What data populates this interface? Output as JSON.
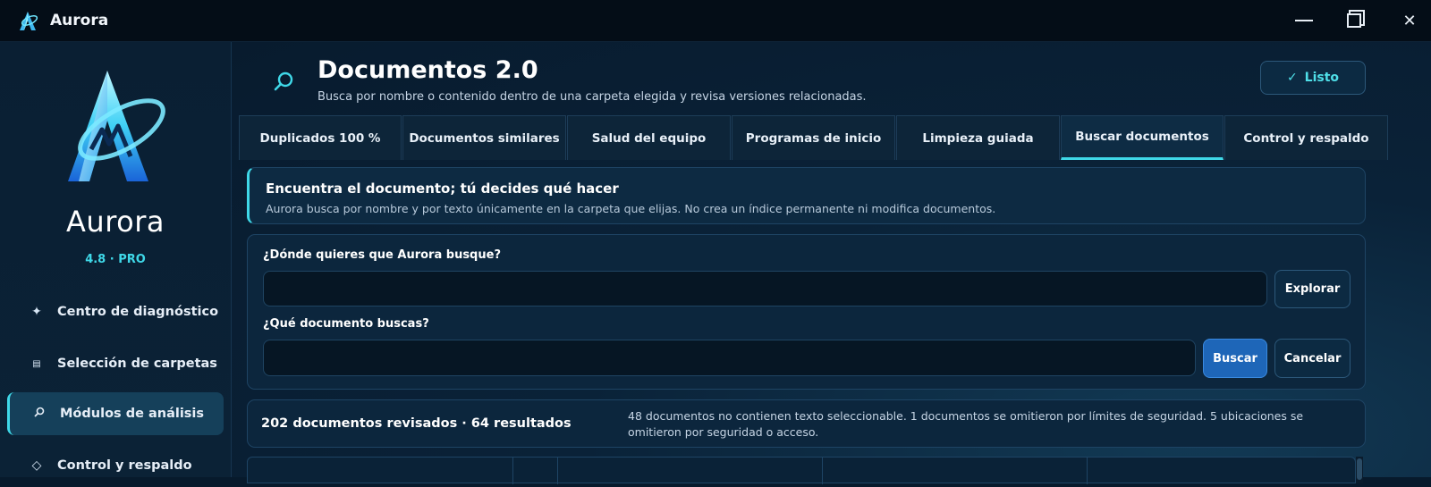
{
  "window": {
    "title": "Aurora",
    "controls": {
      "minimize": "minimize-icon",
      "maximize": "maximize-icon",
      "close": "close-icon"
    }
  },
  "sidebar": {
    "brand_name": "Aurora",
    "version": "4.8 · PRO",
    "items": [
      {
        "label": "Centro de diagnóstico",
        "icon": "sparkle-icon",
        "active": false
      },
      {
        "label": "Selección de carpetas",
        "icon": "folder-list-icon",
        "active": false
      },
      {
        "label": "Módulos de análisis",
        "icon": "search-icon",
        "active": true
      },
      {
        "label": "Control y respaldo",
        "icon": "diamond-icon",
        "active": false
      }
    ]
  },
  "header": {
    "title": "Documentos 2.0",
    "subtitle": "Busca por nombre o contenido dentro de una carpeta elegida y revisa versiones relacionadas.",
    "done_label": "Listo",
    "done_icon": "✓"
  },
  "tabs": [
    {
      "label": "Duplicados 100 %",
      "active": false
    },
    {
      "label": "Documentos similares",
      "active": false
    },
    {
      "label": "Salud del equipo",
      "active": false
    },
    {
      "label": "Programas de inicio",
      "active": false
    },
    {
      "label": "Limpieza guiada",
      "active": false
    },
    {
      "label": "Buscar documentos",
      "active": true
    },
    {
      "label": "Control y respaldo",
      "active": false
    }
  ],
  "info": {
    "title": "Encuentra el documento; tú decides qué hacer",
    "text": "Aurora busca por nombre y por texto únicamente en la carpeta que elijas. No crea un índice permanente ni modifica documentos."
  },
  "form": {
    "location_label": "¿Dónde quieres que Aurora busque?",
    "location_value": "",
    "explore_label": "Explorar",
    "query_label": "¿Qué documento buscas?",
    "query_value": "",
    "search_label": "Buscar",
    "cancel_label": "Cancelar"
  },
  "stats": {
    "summary": "202 documentos revisados · 64 resultados",
    "note": "48 documentos no contienen texto seleccionable. 1 documentos se omitieron por límites de seguridad. 5 ubicaciones se omitieron por seguridad o acceso."
  },
  "colors": {
    "accent": "#3fd8e8",
    "primary_button": "#1e66b8",
    "background": "#071a2c",
    "titlebar": "#040d17"
  }
}
